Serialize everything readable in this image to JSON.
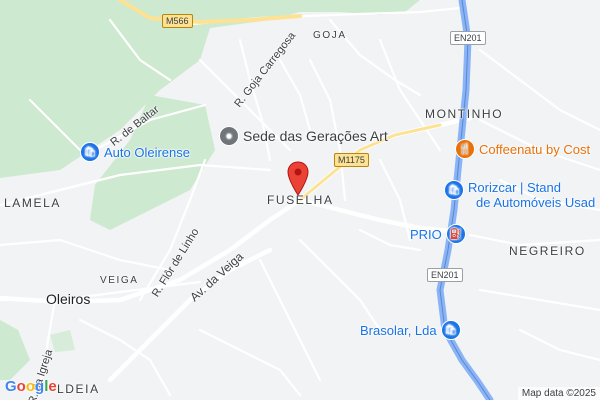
{
  "map": {
    "places": {
      "goja": "GOJA",
      "montinho": "MONTINHO",
      "lamela": "LAMELA",
      "fuselha": "FUSELHA",
      "negreiro": "NEGREIRO",
      "veiga": "VEIGA",
      "oleiros": "Oleiros",
      "aldeia": "LDEIA"
    },
    "streets": {
      "goja_carregosa": "R. Goja Carregosa",
      "baltar": "R. de Baltar",
      "flor_linho": "R. Flôr de Linho",
      "av_veiga": "Av. da Veiga",
      "igreja": "R. da Igreja"
    },
    "road_shields": {
      "m566": "M566",
      "m1175": "M1175",
      "en201_top": "EN201",
      "en201_bottom": "EN201"
    },
    "pois": {
      "auto_oleirense": {
        "label": "Auto Oleirense",
        "icon": "shopping-bag-icon",
        "color": "#1a73e8"
      },
      "sede": {
        "label": "Sede das Gerações Art",
        "icon": "landmark-icon",
        "color": "#70757a"
      },
      "coffeenatu": {
        "label": "Coffeenatu by Cost",
        "icon": "restaurant-icon",
        "color": "#e8710a"
      },
      "rorizcar": {
        "line1": "Rorizcar | Stand",
        "line2": "de Automóveis Usad",
        "icon": "shopping-bag-icon",
        "color": "#1a73e8"
      },
      "prio": {
        "label": "PRIO",
        "icon": "gas-station-icon",
        "color": "#1a73e8"
      },
      "brasolar": {
        "label": "Brasolar, Lda",
        "icon": "shopping-bag-icon",
        "color": "#1a73e8"
      }
    },
    "marker_color": "#ea4335",
    "attribution": "Map data ©2025",
    "logo": [
      "G",
      "o",
      "o",
      "g",
      "l",
      "e"
    ]
  }
}
